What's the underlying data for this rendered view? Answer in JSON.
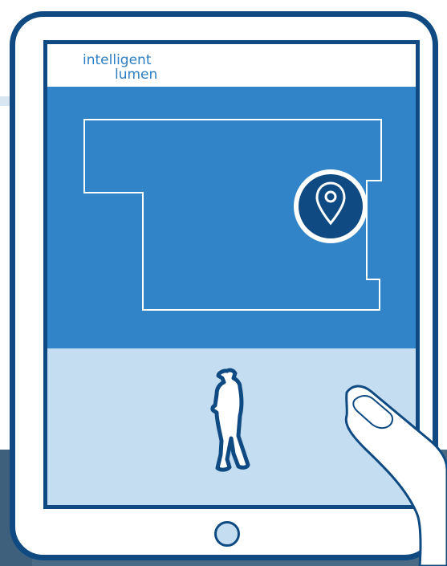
{
  "brand": {
    "line_1": "intelligent",
    "line_2": "lumen",
    "color": "#2d7fc3"
  },
  "icons": {
    "location": "location-pin-icon",
    "person": "person-standing-icon",
    "hand": "hand-pointer-icon",
    "home": "home-button-icon"
  },
  "colors": {
    "frame": "#0f4b82",
    "map_blue": "#3284c8",
    "light_blue": "#c4ddf1",
    "white": "#ffffff"
  }
}
